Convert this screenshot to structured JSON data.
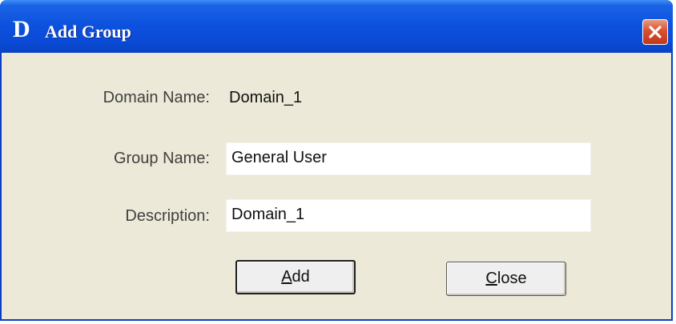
{
  "window": {
    "logo": "D",
    "title": "Add Group"
  },
  "form": {
    "domain_name": {
      "label": "Domain Name:",
      "value": "Domain_1"
    },
    "group_name": {
      "label": "Group Name:",
      "value": "General User"
    },
    "description": {
      "label": "Description:",
      "value": "Domain_1"
    }
  },
  "buttons": {
    "add": {
      "mnemonic": "A",
      "rest": "dd"
    },
    "close": {
      "mnemonic": "C",
      "rest": "lose"
    }
  },
  "icons": {
    "logo": "dlink-logo-icon",
    "close": "close-icon"
  },
  "colors": {
    "titlebar": "#0a4ad6",
    "body": "#ece9d8",
    "close_button": "#d9502f"
  }
}
